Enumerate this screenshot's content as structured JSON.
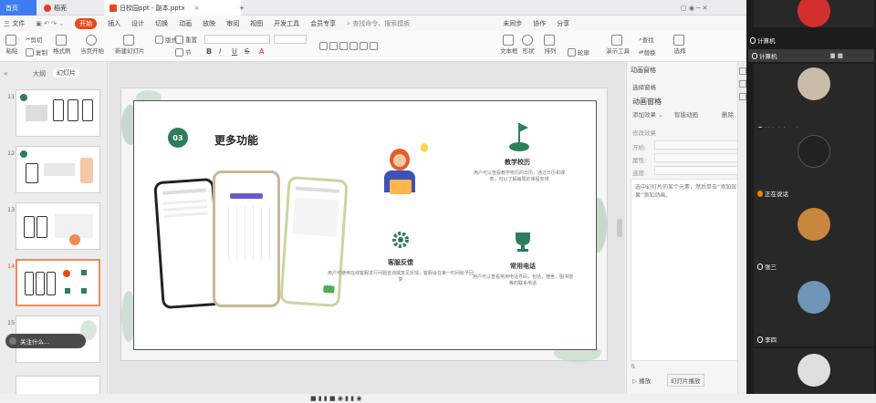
{
  "titlebar": {
    "tabs": [
      "首页",
      "稻壳",
      "日校园ppt - 副本.pptx"
    ]
  },
  "menubar": {
    "file": "三 文件",
    "items": [
      "开始",
      "插入",
      "设计",
      "切换",
      "动画",
      "放映",
      "审阅",
      "视图",
      "开发工具",
      "会员专享"
    ],
    "search": "查找命令、搜索模板",
    "right": [
      "未同步",
      "协作",
      "分享"
    ]
  },
  "toolbar": {
    "items": [
      "粘贴",
      "剪切",
      "复制",
      "格式刷",
      "当页开始",
      "新建幻灯片",
      "版式",
      "节",
      "重置",
      "文本框",
      "形状",
      "排列",
      "轮廓",
      "查找",
      "替换",
      "选择",
      "演示工具"
    ]
  },
  "leftpanel": {
    "tabs": [
      "大纲",
      "幻灯片"
    ],
    "slide_numbers": [
      "11",
      "12",
      "13",
      "14",
      "15"
    ],
    "hint": "关注什么..."
  },
  "slide": {
    "badge": "03",
    "title": "更多功能",
    "features": [
      {
        "title": "教学校历",
        "text": "用户可以查看教学校历的日历，通过日历和课表，可以了解每周的课程安排"
      },
      {
        "title": "客服反馈",
        "text": "用户可使用在线客服进行问题咨询或意见反馈，客服会在第一时间给予回复"
      },
      {
        "title": "常用电话",
        "text": "用户可以查看常用电话号码，包括，宿舍，图书馆等的联系电话"
      }
    ]
  },
  "rightpanel": {
    "header": "动画窗格",
    "select_pane": "选择窗格",
    "title": "动画窗格",
    "add_effect": "添加效果",
    "smart_anim": "智能动画",
    "delete": "删除",
    "modify": "修改效果",
    "start": "开始:",
    "property": "属性:",
    "speed": "速度:",
    "hint": "选中幻灯片的某个元素，然后单击“添加效果”添加动画。",
    "footer_play": "播放",
    "footer_show": "幻灯片播放"
  },
  "meeting": {
    "participants": [
      {
        "name": "",
        "color": "#d32f2f"
      },
      {
        "name": "计算机",
        "color": "#555555"
      },
      {
        "name": "",
        "color": "#c8bca8"
      },
      {
        "name": "就在上午八点",
        "color": ""
      },
      {
        "name": "",
        "color": "#222222"
      },
      {
        "name": "正在说话",
        "color": ""
      },
      {
        "name": "",
        "color": "#c9863f"
      },
      {
        "name": "张三",
        "color": ""
      },
      {
        "name": "",
        "color": "#6f95b8"
      },
      {
        "name": "李四",
        "color": ""
      },
      {
        "name": "",
        "color": "#dedede"
      }
    ],
    "overlay_name": "计算机"
  },
  "colors": {
    "accent": "#e64a19",
    "slide_green": "#2e7d5b",
    "meet_bg": "#1c1c1c"
  }
}
